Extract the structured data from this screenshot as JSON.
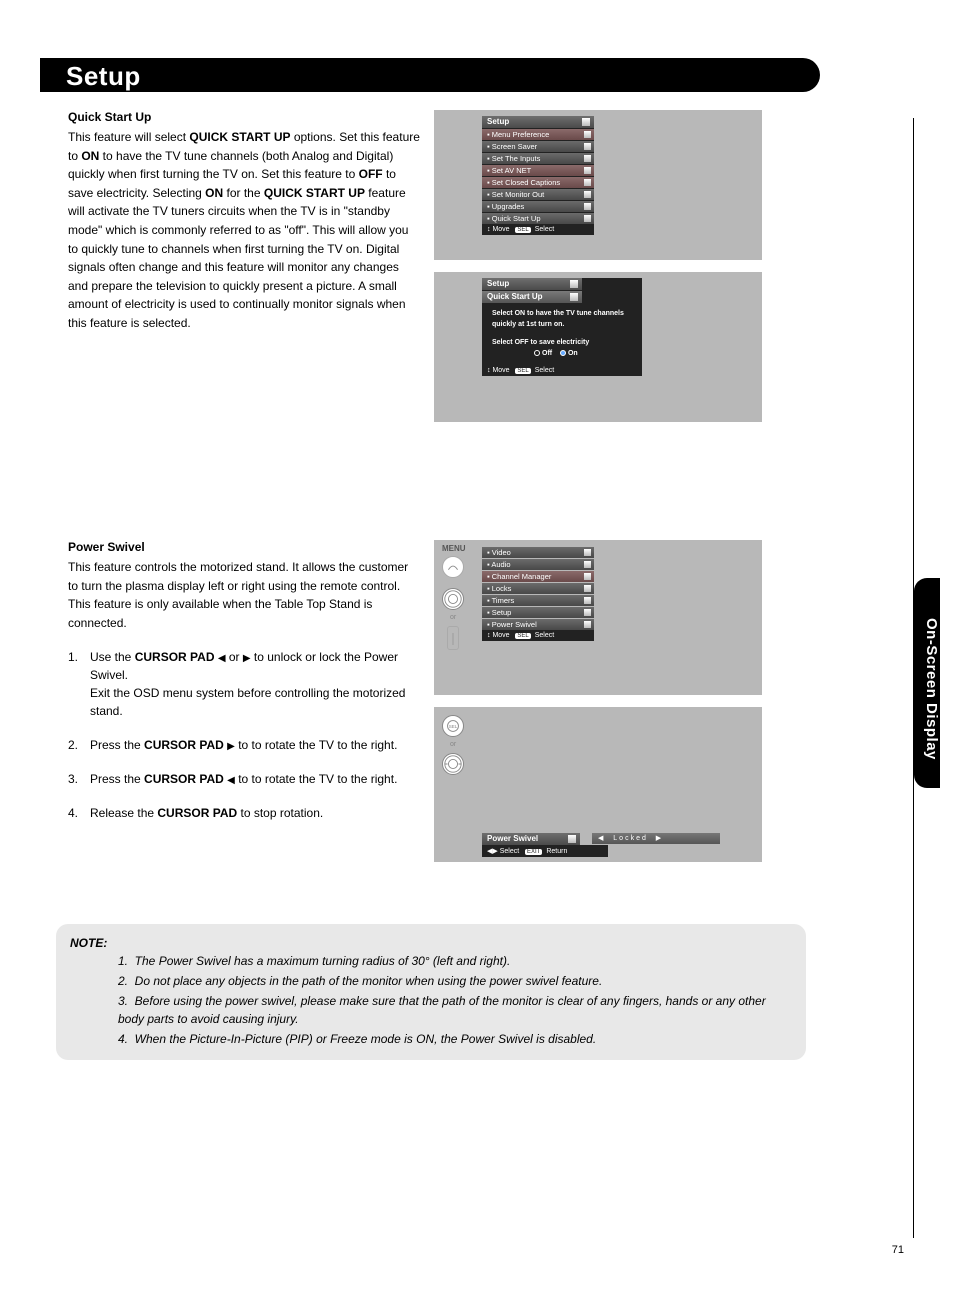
{
  "page_title": "Setup",
  "side_tab": "On-Screen Display",
  "page_number": "71",
  "quick_start": {
    "heading": "Quick Start Up",
    "para": "This feature will select <b>QUICK START UP</b> options. Set this feature to <b>ON</b> to have the TV tune channels (both Analog and Digital) quickly when first turning the TV on. Set this feature to <b>OFF</b> to save electricity. Selecting <b>ON</b> for the <b>QUICK START UP</b> feature will activate the TV tuners circuits when the TV is in \"standby mode\" which is commonly referred to as \"off\". This will allow you to quickly tune to channels when first turning the TV on. Digital signals often change and this feature will monitor any changes and prepare the television to quickly present a picture. A small amount of electricity is used to continually monitor signals when this feature is selected."
  },
  "power_swivel": {
    "heading": "Power Swivel",
    "para": "This feature controls the motorized stand.  It allows the customer to turn the plasma display left or right using the remote control. This feature is only available when the Table Top Stand is connected.",
    "steps": [
      "Use the <b>CURSOR PAD</b> <span class='tri'>◀</span> or <span class='tri'>▶</span> to unlock or lock the Power Swivel.<br>Exit the OSD menu system before controlling the motorized stand.",
      "Press the <b>CURSOR PAD</b> <span class='tri'>▶</span> to to rotate the TV to the right.",
      "Press the <b>CURSOR PAD</b> <span class='tri'>◀</span> to to rotate the TV to the right.",
      "Release the <b>CURSOR PAD</b> to stop rotation."
    ]
  },
  "note": {
    "label": "NOTE:",
    "items": [
      "The Power Swivel has a maximum turning radius of 30° (left and right).",
      "Do not place any objects in the path of the monitor when using the power swivel feature.",
      "Before using the power swivel, please make sure that the path of the monitor is clear of any fingers, hands or any other body parts to avoid causing injury.",
      "When the Picture-In-Picture (PIP) or Freeze mode is ON, the Power Swivel is disabled."
    ]
  },
  "osd1": {
    "title": "Setup",
    "items": [
      "Menu Preference",
      "Screen Saver",
      "Set The Inputs",
      "Set AV NET",
      "Set Closed Captions",
      "Set Monitor Out",
      "Upgrades",
      "Quick Start Up"
    ],
    "foot_move": "Move",
    "foot_sel": "Select",
    "foot_sel_badge": "SEL"
  },
  "osd2": {
    "title": "Setup",
    "sub": "Quick Start Up",
    "info1": "Select ON to have the TV tune channels quickly at 1st turn on.",
    "info2": "Select OFF to save electricity",
    "off": "Off",
    "on": "On",
    "foot_move": "Move",
    "foot_sel": "Select",
    "foot_sel_badge": "SEL"
  },
  "osd3": {
    "items": [
      "Video",
      "Audio",
      "Channel Manager",
      "Locks",
      "Timers",
      "Setup",
      "Power Swivel"
    ],
    "foot_move": "Move",
    "foot_sel": "Select",
    "foot_sel_badge": "SEL",
    "menu_label": "MENU",
    "or": "or"
  },
  "osd4": {
    "title": "Power Swivel",
    "locked": "Locked",
    "foot1": "Select",
    "foot2": "Return",
    "foot2_badge": "EXIT",
    "or": "or"
  }
}
